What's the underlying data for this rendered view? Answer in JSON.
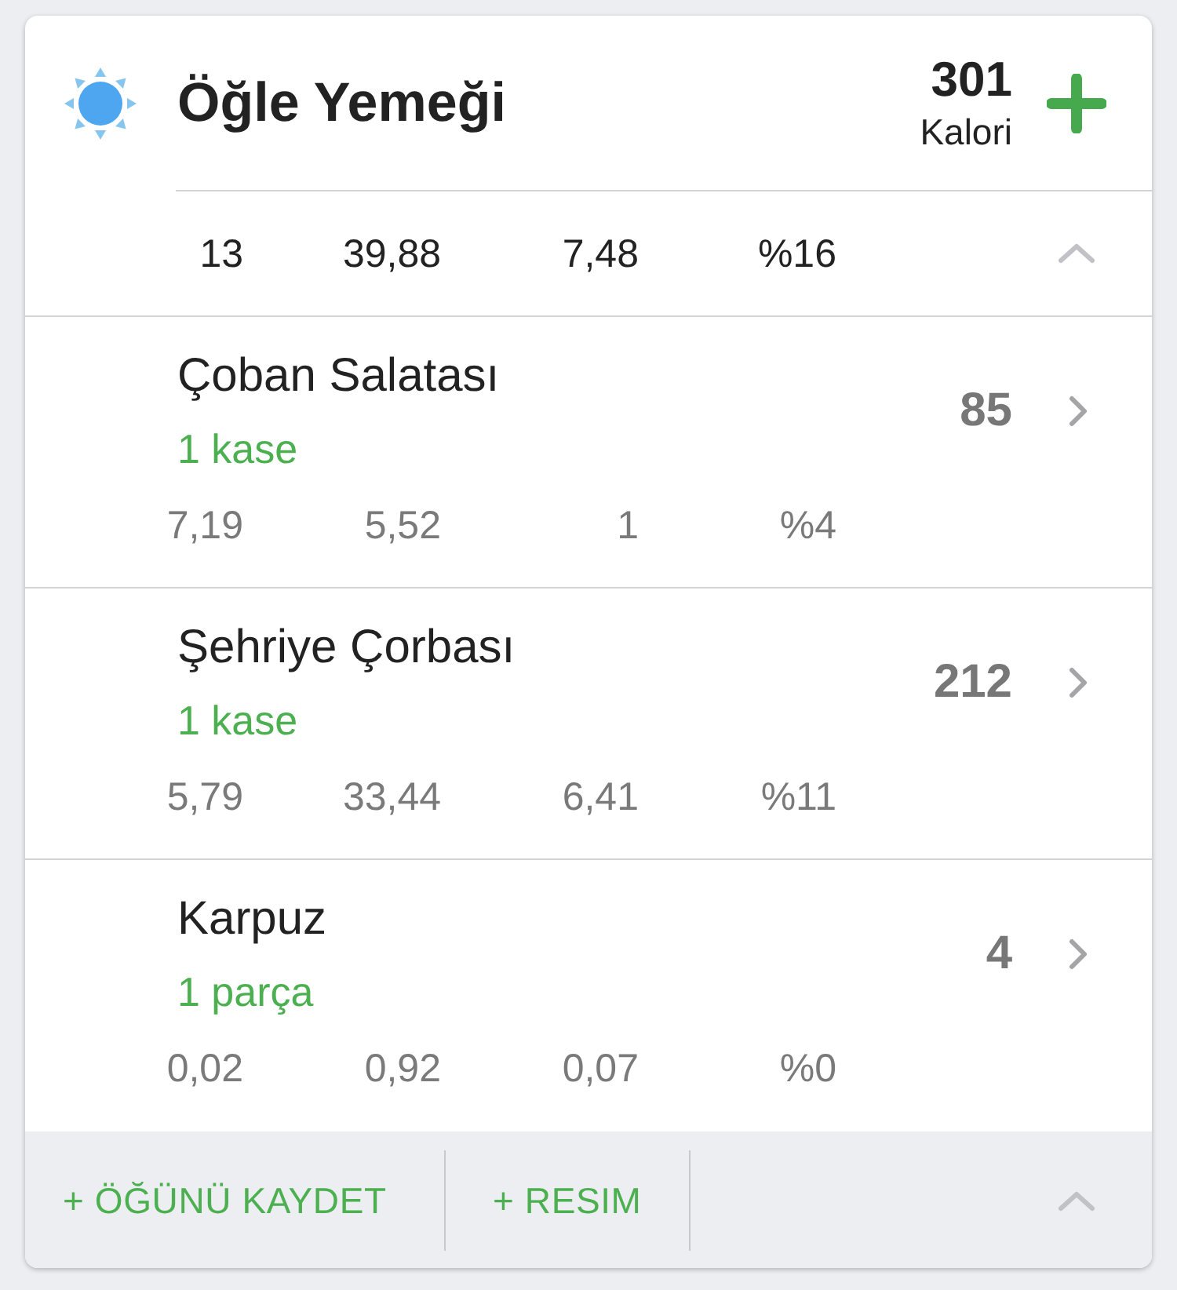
{
  "header": {
    "title": "Öğle Yemeği",
    "calories": "301",
    "calories_label": "Kalori"
  },
  "expanded": true,
  "totals": [
    "13",
    "39,88",
    "7,48",
    "%16"
  ],
  "foods": [
    {
      "name": "Çoban Salatası",
      "serving": "1 kase",
      "calories": "85",
      "macros": [
        "7,19",
        "5,52",
        "1",
        "%4"
      ]
    },
    {
      "name": "Şehriye Çorbası",
      "serving": "1 kase",
      "calories": "212",
      "macros": [
        "5,79",
        "33,44",
        "6,41",
        "%11"
      ]
    },
    {
      "name": "Karpuz",
      "serving": "1 parça",
      "calories": "4",
      "macros": [
        "0,02",
        "0,92",
        "0,07",
        "%0"
      ]
    }
  ],
  "footer": {
    "buttons": [
      "+ ÖĞÜNÜ KAYDET",
      "+ RESIM"
    ]
  }
}
